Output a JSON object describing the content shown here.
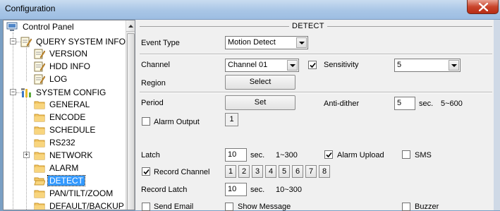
{
  "window": {
    "title": "Configuration"
  },
  "tree": {
    "root": "Control Panel",
    "query_group": "QUERY SYSTEM INFO",
    "query_items": [
      "VERSION",
      "HDD INFO",
      "LOG"
    ],
    "config_group": "SYSTEM CONFIG",
    "config_items": [
      "GENERAL",
      "ENCODE",
      "SCHEDULE",
      "RS232",
      "NETWORK",
      "ALARM",
      "DETECT",
      "PAN/TILT/ZOOM",
      "DEFAULT/BACKUP"
    ],
    "selected": "DETECT"
  },
  "detect": {
    "heading": "DETECT",
    "event_type_label": "Event Type",
    "event_type_value": "Motion Detect",
    "channel_label": "Channel",
    "channel_value": "Channel 01",
    "sensitivity_label": "Sensitivity",
    "sensitivity_value": "5",
    "sensitivity_checked": true,
    "region_label": "Region",
    "select_button": "Select",
    "period_label": "Period",
    "set_button": "Set",
    "anti_dither_label": "Anti-dither",
    "anti_dither_value": "5",
    "anti_dither_unit": "sec.",
    "anti_dither_range": "5~600",
    "alarm_output_label": "Alarm Output",
    "alarm_output_checked": false,
    "alarm_output_channels": [
      "1"
    ],
    "latch_label": "Latch",
    "latch_value": "10",
    "latch_unit": "sec.",
    "latch_range": "1~300",
    "alarm_upload_label": "Alarm Upload",
    "alarm_upload_checked": true,
    "sms_label": "SMS",
    "sms_checked": false,
    "record_channel_label": "Record Channel",
    "record_channel_checked": true,
    "record_channels": [
      "1",
      "2",
      "3",
      "4",
      "5",
      "6",
      "7",
      "8"
    ],
    "record_latch_label": "Record Latch",
    "record_latch_value": "10",
    "record_latch_unit": "sec.",
    "record_latch_range": "10~300",
    "send_email_label": "Send Email",
    "send_email_checked": false,
    "show_message_label": "Show Message",
    "show_message_checked": false,
    "buzzer_label": "Buzzer",
    "buzzer_checked": false
  },
  "colors": {
    "selection": "#3399ff",
    "titlebar": "#a9c6e6",
    "close": "#c9452c"
  },
  "icons": {
    "root": "computer-icon",
    "query_group": "notepad-pencil-icon",
    "query_items": "notepad-pencil-icon",
    "config_group": "tools-icon",
    "config_items": "folder-icon"
  }
}
